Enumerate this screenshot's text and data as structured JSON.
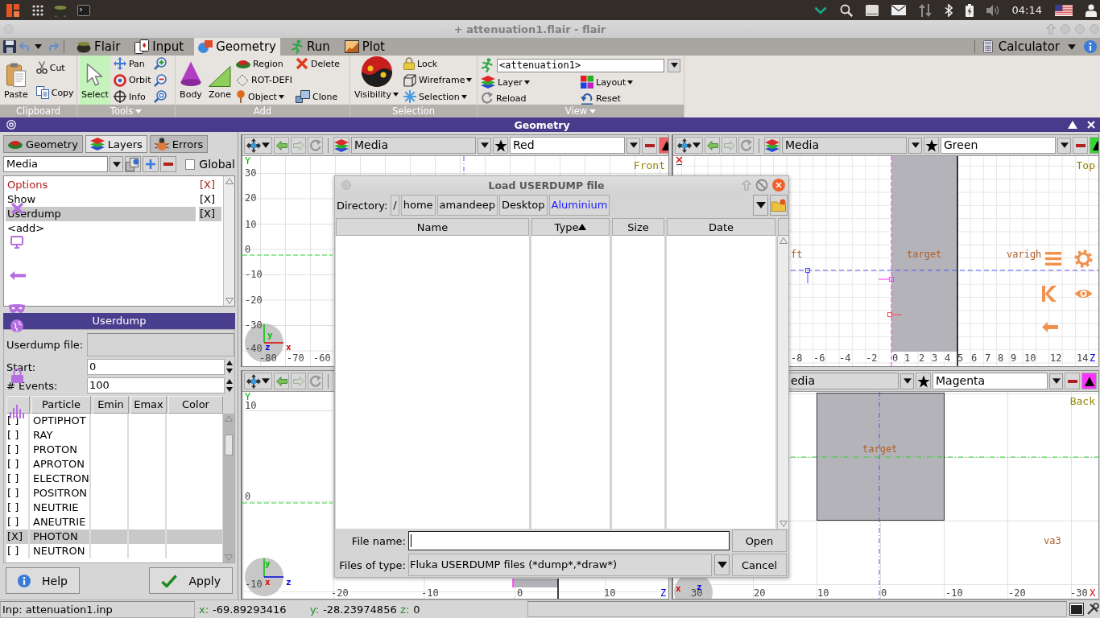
{
  "system_bar": {
    "clock": "04:14"
  },
  "window": {
    "title": "+ attenuation1.flair - flair"
  },
  "toolbar": {
    "tabs": [
      {
        "label": "Flair",
        "selected": false
      },
      {
        "label": "Input",
        "selected": false
      },
      {
        "label": "Geometry",
        "selected": true
      },
      {
        "label": "Run",
        "selected": false
      },
      {
        "label": "Plot",
        "selected": false
      }
    ],
    "calculator": "Calculator"
  },
  "ribbon": {
    "groups": [
      {
        "label": "Clipboard",
        "menu": false,
        "columns": [
          {
            "kind": "large",
            "items": [
              {
                "label": "Paste",
                "menu": false
              }
            ]
          },
          {
            "kind": "small",
            "items": [
              {
                "label": "Cut",
                "menu": false
              },
              {
                "label": "Copy",
                "menu": false
              }
            ]
          }
        ]
      },
      {
        "label": "Tools",
        "menu": true,
        "columns": [
          {
            "kind": "large",
            "items": [
              {
                "label": "Select",
                "menu": false,
                "selected": true
              }
            ]
          },
          {
            "kind": "small",
            "items": [
              {
                "label": "Pan",
                "menu": false,
                "selected": false
              },
              {
                "label": "Orbit",
                "menu": false,
                "selected": false
              },
              {
                "label": "Info",
                "menu": false,
                "selected": false
              }
            ]
          },
          {
            "kind": "icons",
            "items": [
              {
                "selected": false
              },
              {
                "selected": false
              },
              {
                "selected": false
              }
            ]
          }
        ]
      },
      {
        "label": "Add",
        "menu": false,
        "columns": [
          {
            "kind": "large",
            "items": [
              {
                "label": "Body",
                "menu": false
              }
            ]
          },
          {
            "kind": "large",
            "items": [
              {
                "label": "Zone",
                "menu": false
              }
            ]
          },
          {
            "kind": "small",
            "items": [
              {
                "label": "Region",
                "menu": false
              },
              {
                "label": "ROT-DEFI",
                "menu": false
              },
              {
                "label": "Object",
                "menu": true
              }
            ]
          },
          {
            "kind": "small",
            "items": [
              {
                "label": "Delete",
                "menu": false
              },
              {
                "label": "Clone",
                "menu": false
              }
            ]
          }
        ]
      },
      {
        "label": "Selection",
        "menu": false,
        "columns": [
          {
            "kind": "large",
            "items": [
              {
                "label": "Visibility",
                "menu": true
              }
            ]
          },
          {
            "kind": "small",
            "items": [
              {
                "label": "Lock",
                "menu": false
              },
              {
                "label": "Wireframe",
                "menu": true
              },
              {
                "label": "Selection",
                "menu": true
              }
            ]
          }
        ]
      },
      {
        "label": "View",
        "menu": true,
        "combo": "<attenuation1>",
        "columns": [
          {
            "kind": "small",
            "items": [
              {
                "label": "Layer",
                "menu": true
              },
              {
                "label": "Reload",
                "menu": false
              }
            ]
          },
          {
            "kind": "small",
            "items": [
              {
                "label": "Layout",
                "menu": true
              },
              {
                "label": "Reset",
                "menu": false
              }
            ]
          }
        ]
      }
    ]
  },
  "panel_title": "Geometry",
  "left_panel": {
    "tabs": [
      {
        "label": "Geometry",
        "selected": false
      },
      {
        "label": "Layers",
        "selected": true
      },
      {
        "label": "Errors",
        "selected": false
      }
    ],
    "layer_combo": "Media",
    "global": {
      "label": "Global",
      "checked": false
    },
    "layers": [
      {
        "label": "Options",
        "flag": "[X]",
        "color": "#b01c1c",
        "selected": false
      },
      {
        "label": "Show",
        "flag": "[X]",
        "color": "#000000",
        "selected": false
      },
      {
        "label": "Userdump",
        "flag": "[X]",
        "color": "#000000",
        "selected": true
      },
      {
        "label": "<add>",
        "color": "#000000",
        "selected": false
      }
    ],
    "section_title": "Userdump",
    "form": [
      {
        "label": "Userdump file:",
        "kind": "file"
      },
      {
        "label": "Start:",
        "kind": "spin",
        "value": "0"
      },
      {
        "label": "# Events:",
        "kind": "spin",
        "value": "100"
      }
    ],
    "particle_table": {
      "columns": [
        "Particle",
        "Emin",
        "Emax",
        "Color"
      ],
      "rows": [
        {
          "flag": "[ ]",
          "particle": "OPTIPHOT",
          "selected": false
        },
        {
          "flag": "[ ]",
          "particle": "RAY",
          "selected": false
        },
        {
          "flag": "[ ]",
          "particle": "PROTON",
          "selected": false
        },
        {
          "flag": "[ ]",
          "particle": "APROTON",
          "selected": false
        },
        {
          "flag": "[ ]",
          "particle": "ELECTRON",
          "selected": false
        },
        {
          "flag": "[ ]",
          "particle": "POSITRON",
          "selected": false
        },
        {
          "flag": "[ ]",
          "particle": "NEUTRIE",
          "selected": false
        },
        {
          "flag": "[ ]",
          "particle": "ANEUTRIE",
          "selected": false
        },
        {
          "flag": "[X]",
          "particle": "PHOTON",
          "selected": true
        },
        {
          "flag": "[ ]",
          "particle": "NEUTRON",
          "selected": false
        }
      ]
    },
    "buttons": [
      "Help",
      "Apply"
    ]
  },
  "viewports": [
    {
      "layer": "Media",
      "color_name": "Red",
      "color": "#f26161",
      "view": "Front",
      "v_axis": {
        "label": "Y",
        "color": "#00b000"
      },
      "y_ticks": [
        "30",
        "20",
        "10",
        "0",
        "-10",
        "-20",
        "-30",
        "-40"
      ],
      "x_ticks": [
        "-80",
        "-70",
        "-60"
      ],
      "triad": [
        {
          "label": "y",
          "color": "#00c000"
        },
        {
          "label": "z",
          "color": "#0000e0"
        },
        {
          "label": "x",
          "color": "#e00000"
        }
      ]
    },
    {
      "v_axis": {
        "label": "Y",
        "color": "#00b000"
      },
      "y_ticks": [
        "10",
        "0",
        "-10"
      ],
      "x_ticks": [
        "-20",
        "-10",
        "0",
        "10"
      ],
      "h_axis": {
        "label": "Z",
        "color": "#0000e0"
      },
      "triad": [
        {
          "label": "y",
          "color": "#00c000"
        },
        {
          "label": "x",
          "color": "#e00000"
        },
        {
          "label": "z",
          "color": "#0000e0"
        }
      ]
    },
    {
      "layer": "Media",
      "color_name": "Green",
      "color": "#33d633",
      "view": "Top",
      "x_ticks": [
        "-8",
        "-6",
        "-4",
        "-2",
        "0",
        "1",
        "2",
        "3",
        "4",
        "5",
        "6",
        "7",
        "8",
        "9",
        "10",
        "12",
        "14"
      ],
      "h_axis": {
        "label": "Z",
        "color": "#0000e0"
      },
      "labels": [
        "ft",
        "target",
        "varigh"
      ]
    },
    {
      "layer": "edia",
      "color_name": "Magenta",
      "color": "#ff33ff",
      "view": "Back",
      "labels": [
        "target",
        "va3"
      ],
      "x_ticks": [
        "30",
        "20",
        "10",
        "0",
        "-10",
        "-20",
        "-30"
      ],
      "h_axis": {
        "label": "X",
        "color": "#e00000"
      },
      "triad": [
        {
          "label": "x",
          "color": "#e00000"
        },
        {
          "label": "z",
          "color": "#0000e0"
        }
      ]
    }
  ],
  "dialog": {
    "title": "Load USERDUMP file",
    "directory_label": "Directory:",
    "path": [
      {
        "label": "/",
        "selected": false
      },
      {
        "label": "home",
        "selected": false
      },
      {
        "label": "amandeep",
        "selected": false
      },
      {
        "label": "Desktop",
        "selected": false
      },
      {
        "label": "Aluminium",
        "selected": true
      }
    ],
    "columns": [
      {
        "label": "Name",
        "sorted": false
      },
      {
        "label": "Type",
        "sorted": true
      },
      {
        "label": "Size",
        "sorted": false
      },
      {
        "label": "Date",
        "sorted": false
      }
    ],
    "file_name_label": "File name:",
    "file_type_label": "Files of type:",
    "file_type": "Fluka USERDUMP files (*dump*,*draw*)",
    "buttons": [
      "Open",
      "Cancel"
    ]
  },
  "status_bar": {
    "file": "Inp: attenuation1.inp",
    "coords": [
      {
        "label": "x:",
        "value": "-69.89293416"
      },
      {
        "label": "y:",
        "value": "-28.23974856"
      },
      {
        "label": "z:",
        "value": "0"
      }
    ]
  }
}
